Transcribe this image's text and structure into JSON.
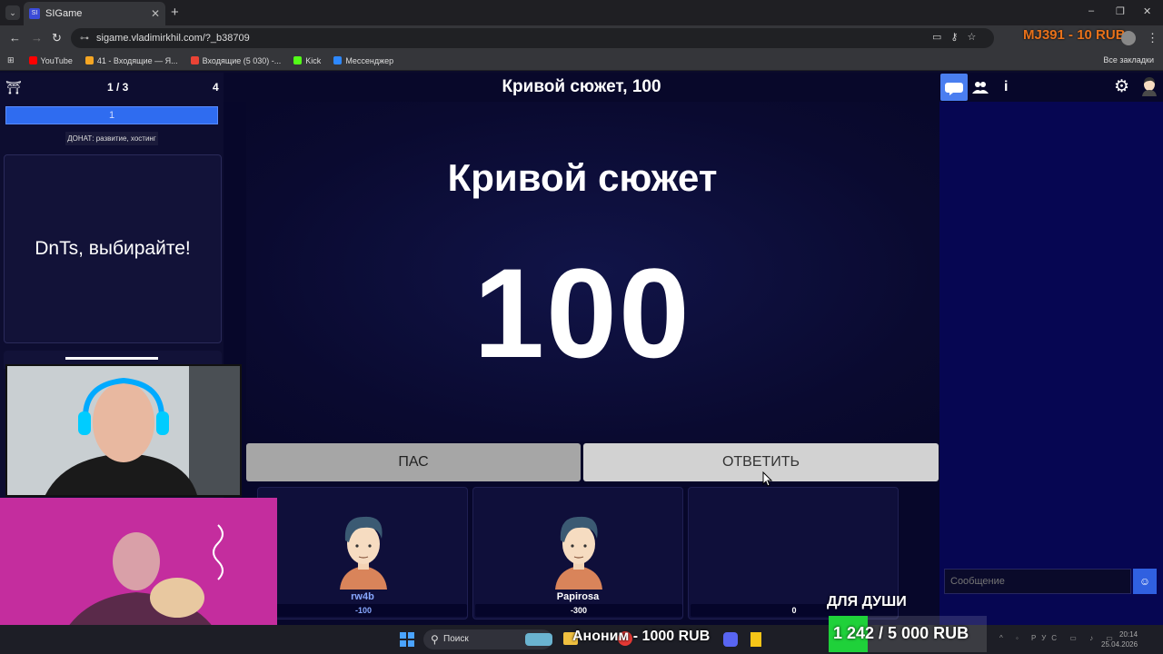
{
  "browser": {
    "tab_title": "SIGame",
    "tab_favicon": "SI",
    "url": "sigame.vladimirkhil.com/?_b38709",
    "bookmarks": [
      {
        "label": "YouTube",
        "color": "#ff0000"
      },
      {
        "label": "41 - Входящие — Я...",
        "color": "#f5a623"
      },
      {
        "label": "Входящие (5 030) -...",
        "color": "#ea4335"
      },
      {
        "label": "Kick",
        "color": "#53fc18"
      },
      {
        "label": "Мессенджер",
        "color": "#2d88ff"
      }
    ],
    "all_bookmarks": "Все закладки",
    "overlay_donation": "MJ391 - 10 RUB"
  },
  "game": {
    "round_counter": "1 / 3",
    "players_count": "4",
    "timer_value": "1",
    "donate_label": "ДОНАТ: развитие, хостинг",
    "host_message": "DnTs, выбирайте!",
    "header_title": "Кривой сюжет, 100",
    "theme_title": "Кривой сюжет",
    "price": "100",
    "pass_label": "ПАС",
    "answer_label": "ОТВЕТИТЬ",
    "players": [
      {
        "name": "rw4b",
        "score": "-100",
        "has_avatar": true
      },
      {
        "name": "Papirosa",
        "score": "-300",
        "has_avatar": true
      },
      {
        "name": "",
        "score": "0",
        "has_avatar": false
      }
    ]
  },
  "chat": {
    "placeholder": "Сообщение"
  },
  "stream_overlay": {
    "donation_flash": "Аноним - 1000 RUB",
    "goal_label": "ДЛЯ ДУШИ",
    "goal_text": "1 242 / 5 000 RUB",
    "goal_progress": 0.2484,
    "goal_color": "#1fd13a"
  },
  "taskbar": {
    "search_placeholder": "Поиск",
    "lang": "РУС",
    "time": "20:14",
    "date": "25.04.2026"
  }
}
